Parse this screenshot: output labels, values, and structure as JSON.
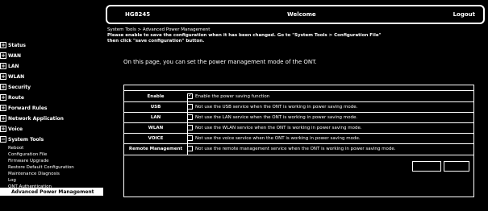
{
  "header": {
    "model": "HG8245",
    "title": "Welcome",
    "logout": "Logout"
  },
  "sidebar": {
    "items": [
      {
        "label": "Status"
      },
      {
        "label": "WAN"
      },
      {
        "label": "LAN"
      },
      {
        "label": "WLAN"
      },
      {
        "label": "Security"
      },
      {
        "label": "Route"
      },
      {
        "label": "Forward Rules"
      },
      {
        "label": "Network Application"
      },
      {
        "label": "Voice"
      },
      {
        "label": "System Tools"
      }
    ],
    "sub_items": [
      {
        "label": "Reboot"
      },
      {
        "label": "Configuration File"
      },
      {
        "label": "Firmware Upgrade"
      },
      {
        "label": "Restore Default Configuration"
      },
      {
        "label": "Maintenance Diagnosis"
      },
      {
        "label": "Log"
      },
      {
        "label": "ONT Authentication"
      }
    ],
    "active": "Advanced Power Management"
  },
  "main": {
    "breadcrumb": "System Tools > Advanced Power Management",
    "notice": "Please enable to save the configuration when it has been changed. Go to \"System Tools > Configuration File\" then click \"save configuration\" button.",
    "intro": "On this page, you can set the power management mode of the ONT.",
    "rows": [
      {
        "label": "Enable",
        "checked": true,
        "desc": "Enable the power saving function"
      },
      {
        "label": "USB",
        "checked": false,
        "desc": "Not use the USB service when the ONT is working in power saving mode."
      },
      {
        "label": "LAN",
        "checked": false,
        "desc": "Not use the LAN service when the ONT is working in power saving mode."
      },
      {
        "label": "WLAN",
        "checked": false,
        "desc": "Not use the WLAN service when the ONT is working in power saving mode."
      },
      {
        "label": "VOICE",
        "checked": false,
        "desc": "Not use the voice service when the ONT is working in power saving mode."
      },
      {
        "label": "Remote Management",
        "checked": false,
        "desc": "Not use the remote management service when the ONT is working in power saving mode."
      }
    ],
    "buttons": {
      "apply": "",
      "cancel": ""
    }
  }
}
